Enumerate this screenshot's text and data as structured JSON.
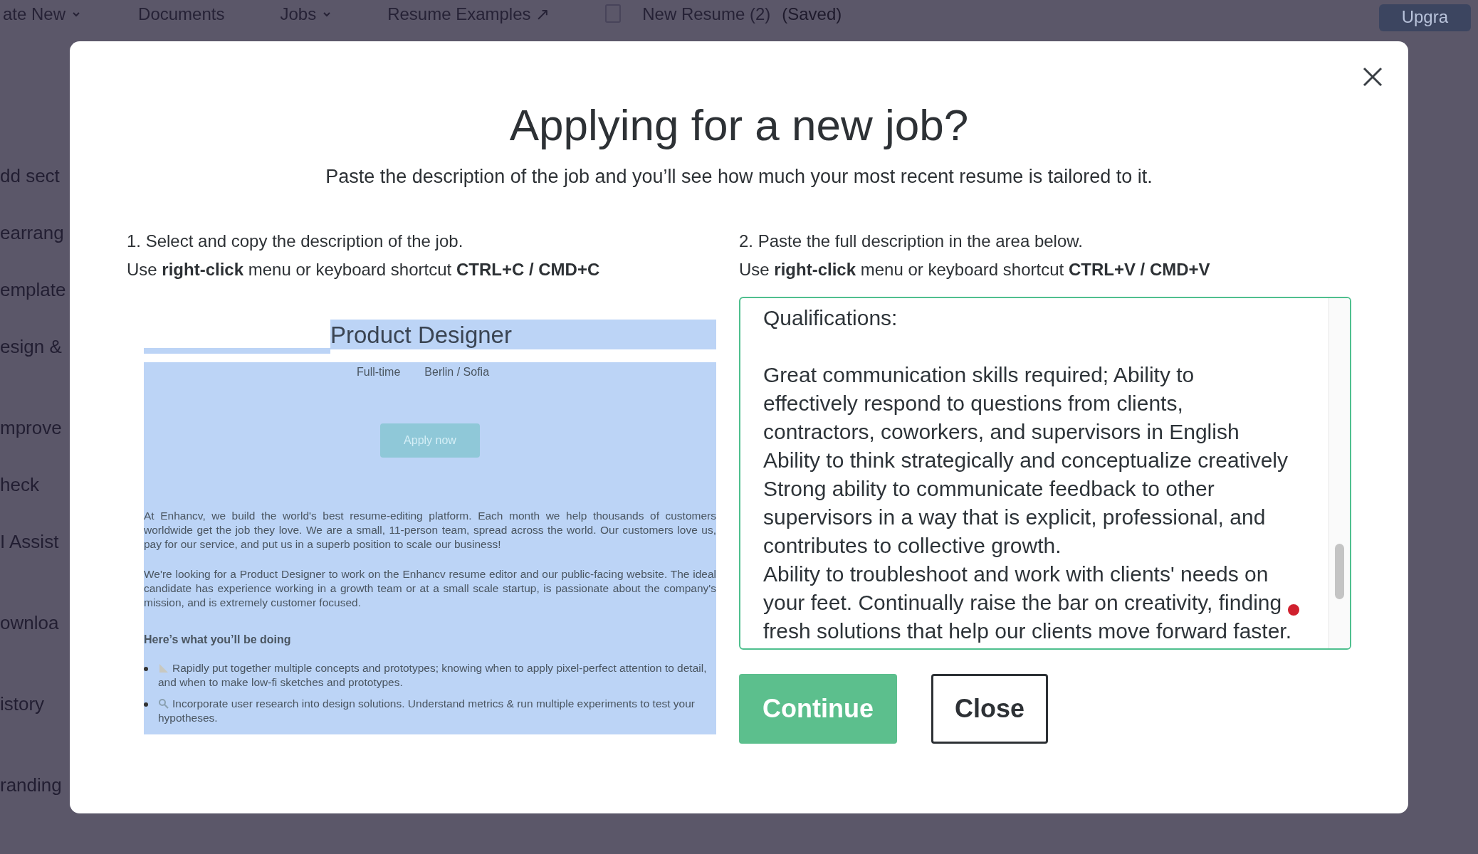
{
  "background": {
    "nav": [
      {
        "label": "ate New",
        "caret": true
      },
      {
        "label": "Documents",
        "caret": false
      },
      {
        "label": "Jobs",
        "caret": true
      },
      {
        "label": "Resume Examples ↗",
        "caret": false
      }
    ],
    "document": {
      "title": "New Resume (2)",
      "status": "(Saved)"
    },
    "upgrade_button": "Upgra",
    "sidebar": [
      "dd sect",
      "earrang",
      "emplate",
      "esign &",
      "mprove",
      "heck",
      "I Assist",
      "ownloa",
      "istory",
      "randing"
    ]
  },
  "dialog": {
    "title": "Applying for a new job?",
    "subtitle": "Paste the description of the job and you’ll see how much your most recent resume is tailored to it.",
    "step_1": {
      "heading": "1. Select and copy the description of the job.",
      "instruction": "Use **right-click** menu or keyboard shortcut **CTRL+C / CMD+C**"
    },
    "step_2": {
      "heading": "2. Paste the full description in the area below.",
      "instruction": "Use **right-click** menu or keyboard shortcut **CTRL+V / CMD+V**"
    },
    "example_page": {
      "title": "Product Designer",
      "meta": [
        "Full-time",
        "Berlin / Sofia"
      ],
      "button": "Apply now",
      "paragraphs": [
        "At Enhancv, we build the world's best resume-editing platform. Each month we help thousands of customers worldwide get the job they love. We are a small, 11-person team, spread across the world. Our customers love us, pay for our service, and put us in a superb position to scale our business!",
        "We're looking for a Product Designer to work on the Enhancv resume editor and our public-facing website. The ideal candidate has experience working in a growth team or at a small scale startup, is passionate about the company's mission, and is extremely customer focused."
      ],
      "section_heading": "Here’s what you’ll be doing",
      "bullets": [
        {
          "kind": "ruler",
          "text": "Rapidly put together multiple concepts and prototypes; knowing when to apply pixel-perfect attention to detail, and when to make low-fi sketches and prototypes."
        },
        {
          "kind": "magnifier",
          "text": "Incorporate user research into design solutions. Understand metrics & run multiple experiments to test your hypotheses."
        }
      ]
    },
    "description_field": {
      "value": "Qualifications:\n\nGreat communication skills required; Ability to effectively respond to questions from clients, contractors, coworkers, and supervisors in English\nAbility to think strategically and conceptualize creatively\nStrong ability to communicate feedback to other supervisors in a way that is explicit, professional, and contributes to collective growth.\nAbility to troubleshoot and work with clients' needs on your feet. Continually raise the bar on creativity, finding fresh solutions that help our clients move forward faster."
    },
    "buttons": [
      {
        "kind": "primary",
        "label": "Continue"
      },
      {
        "kind": "secondary",
        "label": "Close"
      }
    ]
  }
}
